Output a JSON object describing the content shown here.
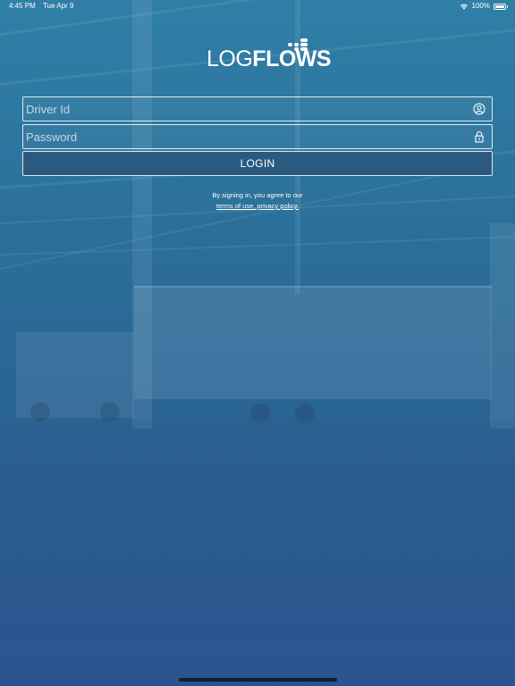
{
  "status_bar": {
    "time": "4:45 PM",
    "date": "Tue Apr 9",
    "battery": "100%",
    "battery_level": 1.0,
    "wifi_icon": "wifi-icon",
    "battery_icon": "battery-icon"
  },
  "logo": {
    "light_part": "LOG",
    "bold_part": "FLOWS"
  },
  "form": {
    "driver_id": {
      "placeholder": "Driver Id",
      "value": "",
      "icon": "user-circle-icon"
    },
    "password": {
      "placeholder": "Password",
      "value": "",
      "icon": "lock-icon"
    },
    "login_label": "LOGIN"
  },
  "terms": {
    "text": "By signing in, you agree to our",
    "link": "terms of use, privacy policy."
  },
  "colors": {
    "background_top": "#2f7fa6",
    "background_bottom": "#2c5690",
    "button": "#2a5a80",
    "text": "#ffffff"
  }
}
